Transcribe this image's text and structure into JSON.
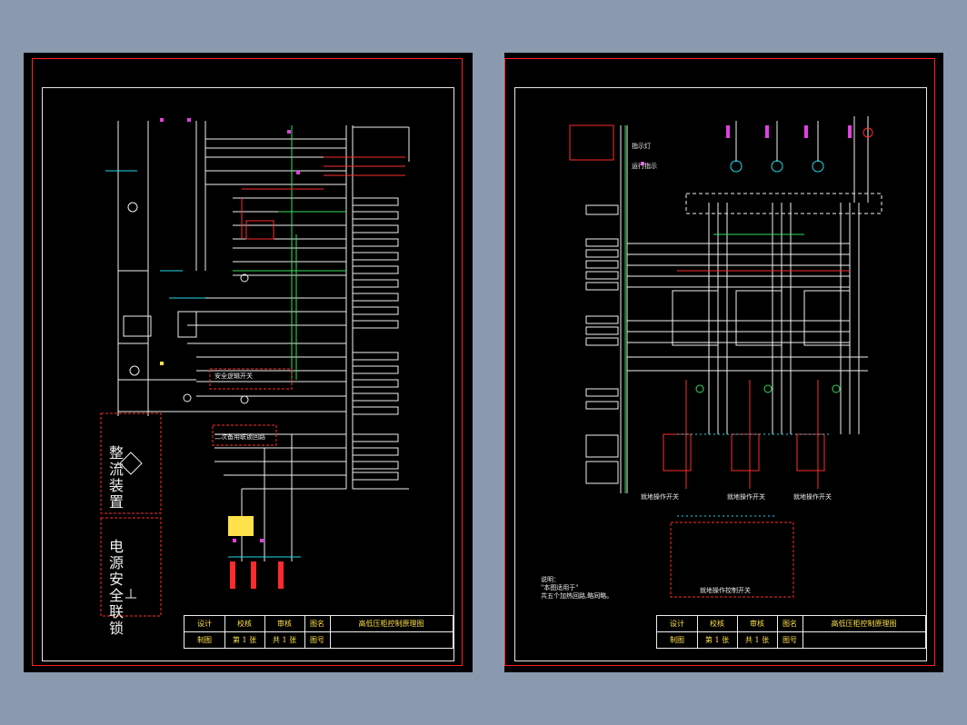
{
  "left_sheet": {
    "title_block": {
      "row1": [
        "设计",
        "校核",
        "审核",
        "图名",
        "高低压柜控制原理图"
      ],
      "row2": [
        "制图",
        "第 1 张",
        "共 1 张",
        "图号",
        ""
      ]
    },
    "labels": {
      "logic_switch": "安全逻辑开关",
      "aux_circuit": "二次备用联锁回路",
      "rectifier": "整流装置",
      "safety": "电源安全联锁"
    }
  },
  "right_sheet": {
    "title_block": {
      "row1": [
        "设计",
        "校核",
        "审核",
        "图名",
        "高低压柜控制原理图"
      ],
      "row2": [
        "制图",
        "第 1 张",
        "共 1 张",
        "图号",
        ""
      ]
    },
    "labels": {
      "status": "运行指示",
      "indicator": "指示灯",
      "note_title": "说明：",
      "note_line1": "\"本图适用于\"",
      "note_line2": "共五个加热回路,略同略。",
      "control_box": "就地操作控制开关",
      "switch1": "就地操作开关",
      "switch2": "就地操作开关",
      "switch3": "就地操作开关"
    }
  }
}
